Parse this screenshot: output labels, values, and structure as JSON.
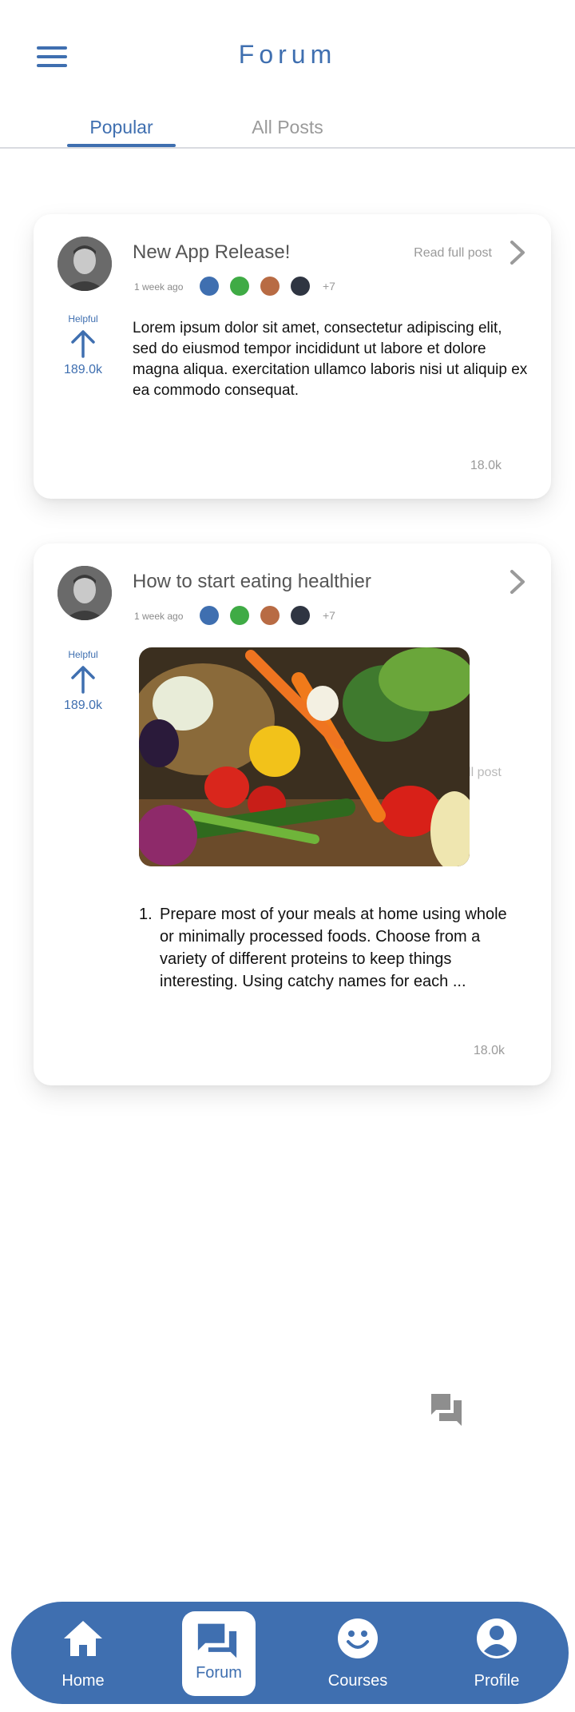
{
  "header": {
    "title": "Forum",
    "menu_icon": "hamburger-menu-icon"
  },
  "tabs": [
    {
      "label": "Popular",
      "active": true
    },
    {
      "label": "All Posts",
      "active": false
    }
  ],
  "posts": [
    {
      "title": "New App Release!",
      "read_full_label": "Read full post",
      "time": "1 week ago",
      "participant_colors": [
        "#3f6fb0",
        "#3fab45",
        "#b86b44",
        "#2f3542"
      ],
      "more_participants": "+7",
      "helpful_label": "Helpful",
      "helpful_count": "189.0k",
      "body": "Lorem ipsum dolor sit amet, consectetur adipiscing elit, sed do eiusmod tempor incididunt ut labore et dolore magna aliqua. exercitation ullamco laboris nisi ut aliquip ex ea commodo consequat.",
      "count": "18.0k"
    },
    {
      "title": "How to start eating healthier",
      "ghost_read_label": "Read full post",
      "time": "1 week ago",
      "participant_colors": [
        "#3f6fb0",
        "#3fab45",
        "#b86b44",
        "#2f3542"
      ],
      "more_participants": "+7",
      "helpful_label": "Helpful",
      "helpful_count": "189.0k",
      "list_number": "1.",
      "list_text": "Prepare most of your meals at home using whole or minimally processed foods. Choose from a variety of different proteins to keep things interesting. Using catchy names for each ...",
      "count": "18.0k"
    }
  ],
  "fab": {
    "icon": "forum-chat-icon"
  },
  "bottom_nav": [
    {
      "label": "Home",
      "icon": "home-icon"
    },
    {
      "label": "Forum",
      "icon": "forum-icon",
      "active": true
    },
    {
      "label": "Courses",
      "icon": "smiley-icon"
    },
    {
      "label": "Profile",
      "icon": "user-circle-icon"
    }
  ],
  "colors": {
    "accent": "#3f6fb0",
    "muted": "#9a9a9a"
  }
}
